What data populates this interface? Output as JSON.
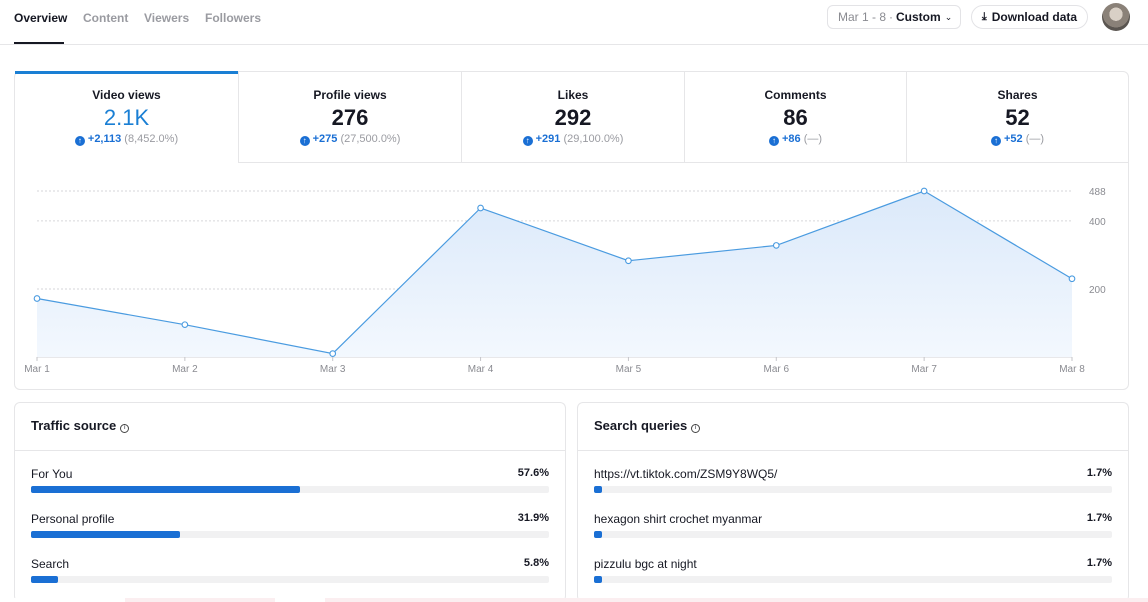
{
  "nav": {
    "tabs": [
      {
        "label": "Overview",
        "active": true
      },
      {
        "label": "Content",
        "active": false
      },
      {
        "label": "Viewers",
        "active": false
      },
      {
        "label": "Followers",
        "active": false
      }
    ],
    "date_range": "Mar 1 - 8",
    "date_separator": "·",
    "date_mode": "Custom",
    "download_label": "Download data"
  },
  "metrics": [
    {
      "label": "Video views",
      "value": "2.1K",
      "delta": "+2,113",
      "pct": "(8,452.0%)"
    },
    {
      "label": "Profile views",
      "value": "276",
      "delta": "+275",
      "pct": "(27,500.0%)"
    },
    {
      "label": "Likes",
      "value": "292",
      "delta": "+291",
      "pct": "(29,100.0%)"
    },
    {
      "label": "Comments",
      "value": "86",
      "delta": "+86",
      "pct": "(—)"
    },
    {
      "label": "Shares",
      "value": "52",
      "delta": "+52",
      "pct": "(—)"
    }
  ],
  "chart_data": {
    "type": "area",
    "series_metric": "Video views",
    "categories": [
      "Mar 1",
      "Mar 2",
      "Mar 3",
      "Mar 4",
      "Mar 5",
      "Mar 6",
      "Mar 7",
      "Mar 8"
    ],
    "values": [
      172,
      95,
      10,
      438,
      283,
      328,
      488,
      230
    ],
    "y_ticks": [
      200,
      400,
      488
    ],
    "ylim": [
      0,
      488
    ],
    "grid": true,
    "colors": {
      "line": "#4a9be0",
      "fill_top": "#dbe9fa",
      "fill_bottom": "#f3f8fe"
    }
  },
  "traffic": {
    "title": "Traffic source",
    "rows": [
      {
        "label": "For You",
        "value": "57.6%",
        "pct": 57.6
      },
      {
        "label": "Personal profile",
        "value": "31.9%",
        "pct": 31.9
      },
      {
        "label": "Search",
        "value": "5.8%",
        "pct": 5.8
      }
    ]
  },
  "queries": {
    "title": "Search queries",
    "rows": [
      {
        "label": "https://vt.tiktok.com/ZSM9Y8WQ5/",
        "value": "1.7%",
        "pct": 1.7
      },
      {
        "label": "hexagon shirt crochet myanmar",
        "value": "1.7%",
        "pct": 1.7
      },
      {
        "label": "pizzulu bgc at night",
        "value": "1.7%",
        "pct": 1.7
      }
    ]
  },
  "colors": {
    "accent": "#1a7fd4",
    "bar": "#1a6fd4"
  }
}
